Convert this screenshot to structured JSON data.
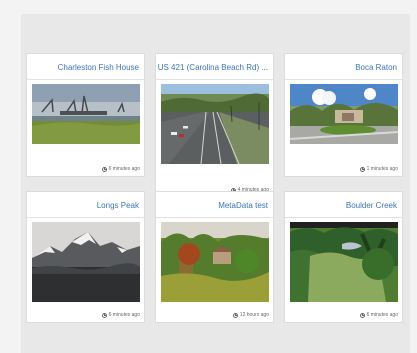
{
  "cards": [
    {
      "title": "Charleston Fish House",
      "time": "6 minutes ago"
    },
    {
      "title": "US 421 (Carolina Beach Rd) ...",
      "time": "4 minutes ago"
    },
    {
      "title": "Boca Raton",
      "time": "1 minutes ago"
    },
    {
      "title": "Longs Peak",
      "time": "6 minutes ago"
    },
    {
      "title": "MetaData test",
      "time": "12 hours ago"
    },
    {
      "title": "Boulder Creek",
      "time": "6 minutes ago"
    }
  ]
}
